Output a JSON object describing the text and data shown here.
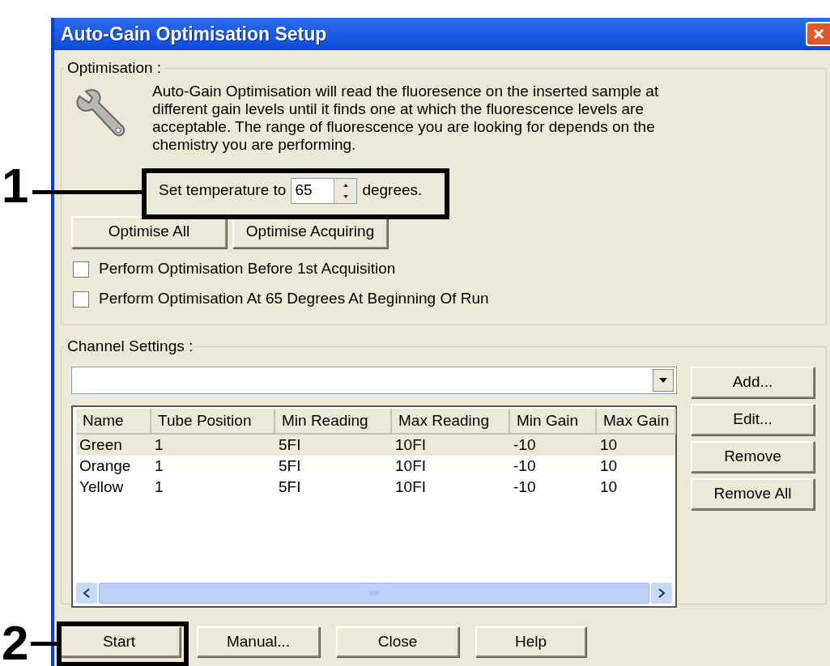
{
  "window": {
    "title": "Auto-Gain Optimisation Setup"
  },
  "optimisation": {
    "legend": "Optimisation :",
    "description": "Auto-Gain Optimisation will read the fluoresence on the inserted sample at different gain levels until it finds one at which the fluorescence levels are acceptable. The range of fluorescence you are looking for depends on the chemistry you are performing.",
    "temperature_label": "Set temperature to",
    "temperature_value": "65",
    "temperature_unit": "degrees.",
    "buttons": [
      "Optimise All",
      "Optimise Acquiring"
    ],
    "options": [
      {
        "label": "Perform Optimisation Before 1st Acquisition",
        "checked": false
      },
      {
        "label": "Perform Optimisation At 65 Degrees At Beginning Of Run",
        "checked": false
      }
    ]
  },
  "channel_settings": {
    "legend": "Channel Settings :",
    "columns": [
      "Name",
      "Tube Position",
      "Min Reading",
      "Max Reading",
      "Min Gain",
      "Max Gain"
    ],
    "rows": [
      {
        "cells": [
          "Green",
          "1",
          "5FI",
          "10FI",
          "-10",
          "10"
        ],
        "selected": true
      },
      {
        "cells": [
          "Orange",
          "1",
          "5FI",
          "10FI",
          "-10",
          "10"
        ],
        "selected": false
      },
      {
        "cells": [
          "Yellow",
          "1",
          "5FI",
          "10FI",
          "-10",
          "10"
        ],
        "selected": false
      }
    ],
    "side_buttons": [
      "Add...",
      "Edit...",
      "Remove",
      "Remove All"
    ]
  },
  "footer_buttons": [
    "Start",
    "Manual...",
    "Close",
    "Help"
  ],
  "annotations": [
    {
      "label": "1"
    },
    {
      "label": "2"
    }
  ]
}
